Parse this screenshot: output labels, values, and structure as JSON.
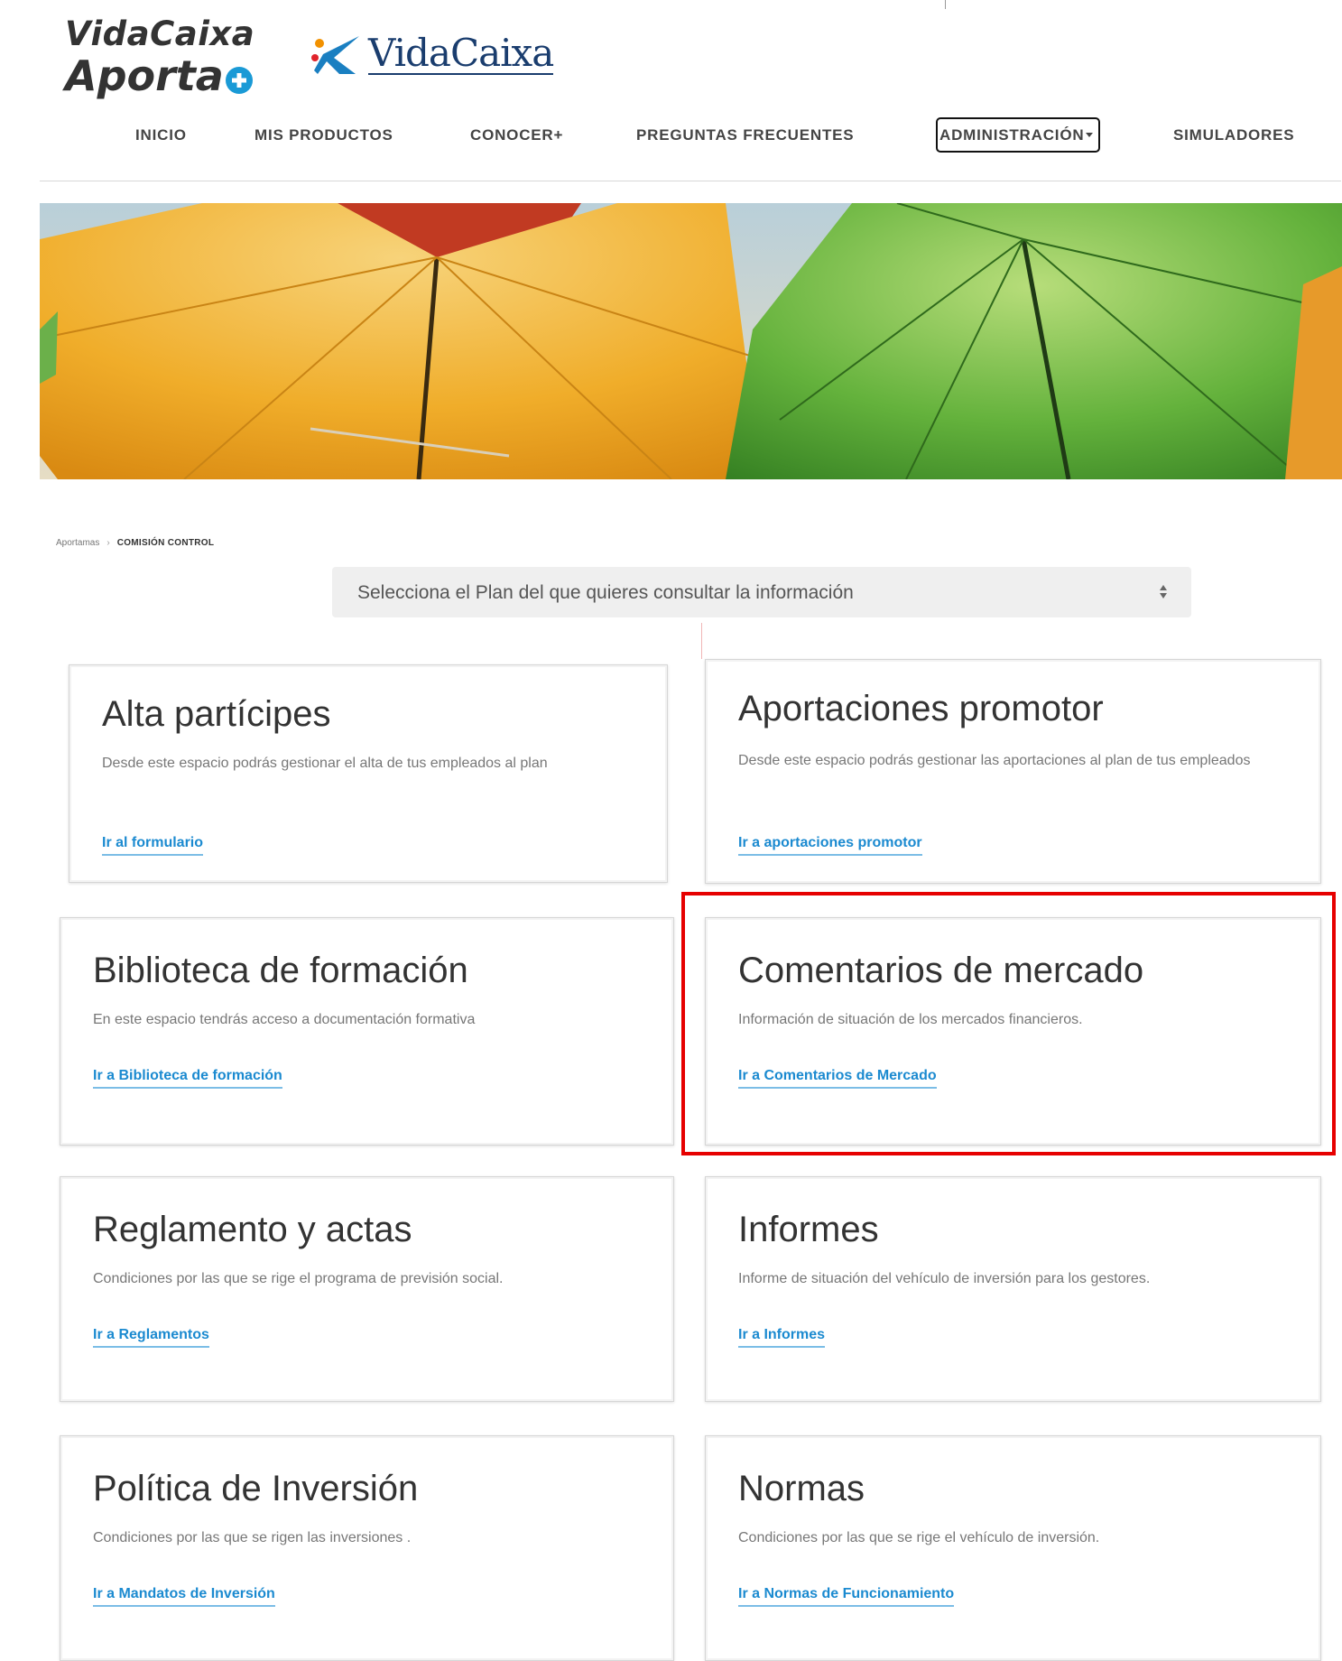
{
  "header": {
    "logo_aporta": {
      "line1": "VidaCaixa",
      "line2": "Aporta"
    },
    "logo_vidacaixa": "VidaCaixa",
    "brand_colors": {
      "plus_blue": "#1a9ad6",
      "star_blue": "#1a7fc1",
      "star_orange": "#f29100",
      "vc_navy": "#1a3d6e"
    }
  },
  "nav": {
    "items": [
      "INICIO",
      "MIS PRODUCTOS",
      "CONOCER+",
      "PREGUNTAS FRECUENTES",
      "ADMINISTRACIÓN",
      "SIMULADORES"
    ],
    "active_index": 4
  },
  "banner": {
    "image": "colorful umbrellas banner (orange and green umbrellas against sky)"
  },
  "breadcrumb": {
    "parent": "Aportamas",
    "current": "COMISIÓN CONTROL"
  },
  "plan_select": {
    "placeholder": "Selecciona el Plan del que quieres consultar la información"
  },
  "cards": [
    {
      "title": "Alta partícipes",
      "desc": "Desde este espacio podrás gestionar el alta de tus empleados al plan",
      "link": "Ir al formulario"
    },
    {
      "title": "Aportaciones promotor",
      "desc": "Desde este espacio podrás gestionar las aportaciones al plan de tus empleados",
      "link": "Ir a aportaciones promotor"
    },
    {
      "title": "Biblioteca de formación",
      "desc": "En este espacio tendrás acceso a documentación formativa",
      "link": "Ir a Biblioteca de formación"
    },
    {
      "title": "Comentarios de mercado",
      "desc": "Información de situación de los mercados financieros.",
      "link": "Ir a Comentarios de Mercado"
    },
    {
      "title": "Reglamento y actas",
      "desc": "Condiciones por las que se rige el programa de previsión social.",
      "link": "Ir a Reglamentos"
    },
    {
      "title": "Informes",
      "desc": "Informe de situación del vehículo de inversión para los gestores.",
      "link": "Ir a Informes"
    },
    {
      "title": "Política de Inversión",
      "desc": "Condiciones por las que se rigen las inversiones .",
      "link": "Ir a Mandatos de Inversión"
    },
    {
      "title": "Normas",
      "desc": "Condiciones por las que se rige el vehículo de inversión.",
      "link": "Ir a Normas de Funcionamiento"
    }
  ],
  "highlight_color": "#e60000",
  "link_color": "#1b8ad0"
}
